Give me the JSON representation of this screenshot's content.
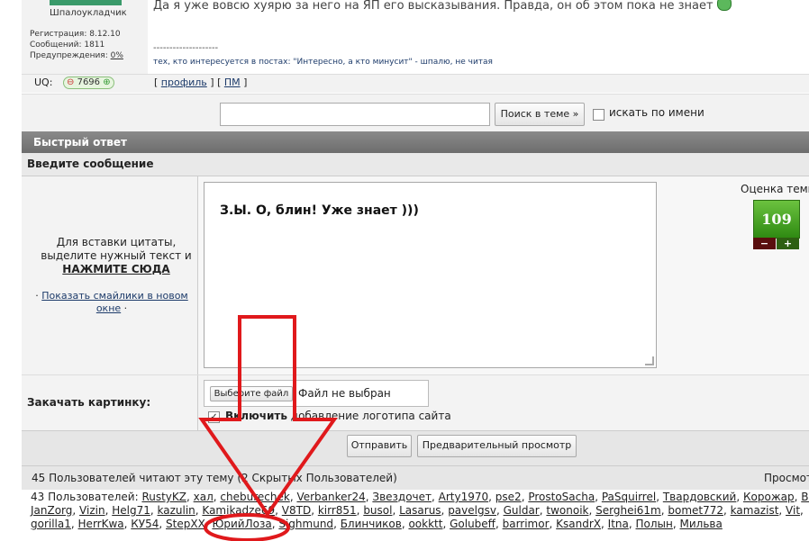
{
  "post": {
    "username": "Шпалоукладчик",
    "reg_label": "Регистрация:",
    "reg_value": "8.12.10",
    "posts_label": "Сообщений:",
    "posts_value": "1811",
    "warn_label": "Предупреждения:",
    "warn_value": "0%",
    "text": "Да я уже вовсю хуярю за него на ЯП его высказывания. Правда, он об этом пока не знает",
    "signature_line": "--------------------",
    "signature_text": "тех, кто интересуется в постах: \"Интересно, а кто минусит\" - шпалю, не читая",
    "uq_label": "UQ:",
    "uq_value": "7696",
    "profile_link": "профиль",
    "pm_link": "ПМ"
  },
  "search": {
    "input_value": "",
    "button_label": "Поиск в теме »",
    "by_name_label": "искать по имени"
  },
  "quick_reply": {
    "header": "Быстрый ответ",
    "message_header": "Введите сообщение",
    "quote_hint": "Для вставки цитаты, выделите нужный текст и",
    "quote_click": "НАЖМИТЕ СЮДА",
    "smilies_link": "Показать смайлики в новом окне",
    "message_text": "З.Ы. О, блин! Уже знает )))",
    "rating_label": "Оценка темы",
    "rating_value": "109",
    "upload_label": "Закачать картинку:",
    "file_button": "Выберите файл",
    "file_status": "Файл не выбран",
    "logo_bold": "Включить",
    "logo_rest": "добавление логотипа сайта",
    "submit_label": "Отправить",
    "preview_label": "Предварительный просмотр"
  },
  "readers": {
    "header": "45 Пользователей читают эту тему (2 Скрытых Пользователей)",
    "right_label": "Просмотр",
    "line1_prefix": "43 Пользователей:",
    "line1": [
      "RustyKZ",
      "хал",
      "cheburechek",
      "Verbanker24",
      "Звездочет",
      "Arty1970",
      "pse2",
      "ProstoSacha",
      "PaSquirrel",
      "Твардовский",
      "Корожар",
      "Bos"
    ],
    "line2": [
      "JanZorg",
      "Vizin",
      "Helg71",
      "kazulin",
      "Kamikadze69",
      "V8TD",
      "kirr851",
      "busol",
      "Lasarus",
      "pavelgsv",
      "Guldar",
      "twonoik",
      "Serghei61m",
      "bomet772",
      "kamazist",
      "Vit"
    ],
    "line3": [
      "gorilla1",
      "HerrKwa",
      "КУ54",
      "StepXX",
      "ЮрийЛоза",
      "Sighmund",
      "Блинчиков",
      "ookktt",
      "Golubeff",
      "barrimor",
      "KsandrX",
      "Itna",
      "Полын",
      "Мильва"
    ]
  },
  "colors": {
    "annotation": "#e0191c",
    "link": "#1d3b6a",
    "rating": "#3f9d1f"
  }
}
